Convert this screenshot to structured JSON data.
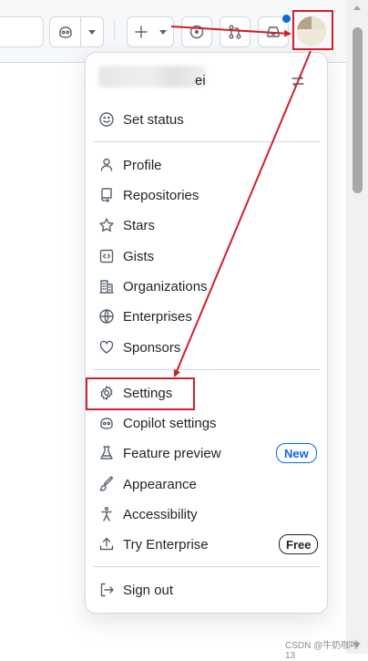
{
  "header": {
    "copilot_icon": "copilot-icon",
    "new_icon": "plus-icon",
    "issues_icon": "issue-opened-icon",
    "pulls_icon": "git-pull-request-icon",
    "inbox_icon": "inbox-icon",
    "notification_dot_color": "#0969da"
  },
  "menu": {
    "user_name_visible": "ei",
    "items": [
      {
        "label": "Set status",
        "icon": "smiley-icon"
      },
      {
        "label": "Profile",
        "icon": "person-icon"
      },
      {
        "label": "Repositories",
        "icon": "repo-icon"
      },
      {
        "label": "Stars",
        "icon": "star-icon"
      },
      {
        "label": "Gists",
        "icon": "code-square-icon"
      },
      {
        "label": "Organizations",
        "icon": "organization-icon"
      },
      {
        "label": "Enterprises",
        "icon": "globe-icon"
      },
      {
        "label": "Sponsors",
        "icon": "heart-icon"
      },
      {
        "label": "Settings",
        "icon": "gear-icon"
      },
      {
        "label": "Copilot settings",
        "icon": "copilot-icon"
      },
      {
        "label": "Feature preview",
        "icon": "beaker-icon",
        "badge": "New"
      },
      {
        "label": "Appearance",
        "icon": "paintbrush-icon"
      },
      {
        "label": "Accessibility",
        "icon": "accessibility-icon"
      },
      {
        "label": "Try Enterprise",
        "icon": "upload-icon",
        "badge": "Free"
      },
      {
        "label": "Sign out",
        "icon": "sign-out-icon"
      }
    ]
  },
  "annotation_color": "#d0202b",
  "watermark": "CSDN @牛奶咖啡13"
}
